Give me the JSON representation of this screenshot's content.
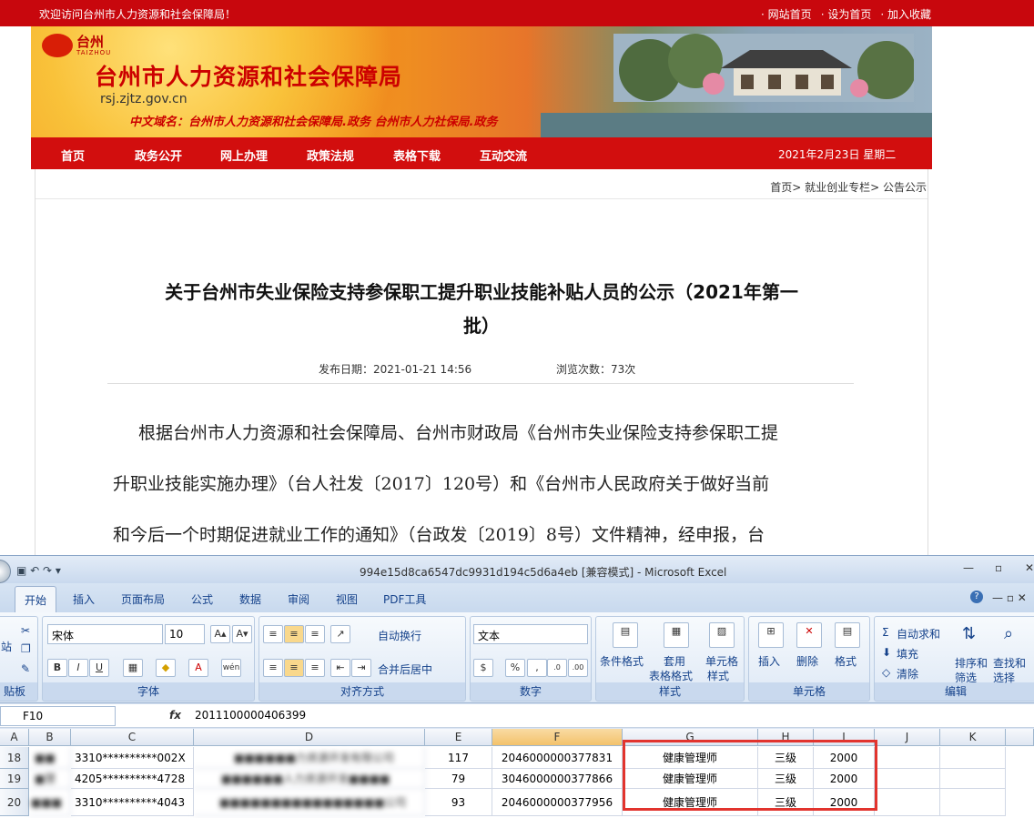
{
  "topbar": {
    "welcome": "欢迎访问台州市人力资源和社会保障局！",
    "links": [
      "网站首页",
      "设为首页",
      "加入收藏"
    ]
  },
  "banner": {
    "logo_text": "台州",
    "logo_sub": "TAIZHOU",
    "org_name": "台州市人力资源和社会保障局",
    "domain": "rsj.zjtz.gov.cn",
    "cn_domain": "中文域名：台州市人力资源和社会保障局.政务   台州市人力社保局.政务"
  },
  "nav": {
    "items": [
      "首页",
      "政务公开",
      "网上办理",
      "政策法规",
      "表格下载",
      "互动交流"
    ],
    "date": "2021年2月23日    星期二"
  },
  "breadcrumb": "首页> 就业创业专栏> 公告公示",
  "article": {
    "title_line1": "关于台州市失业保险支持参保职工提升职业技能补贴人员的公示（2021年第一",
    "title_line2": "批）",
    "publish_date": "发布日期：2021-01-21 14:56",
    "views": "浏览次数：73次",
    "body_lines": [
      "根据台州市人力资源和社会保障局、台州市财政局《台州市失业保险支持参保职工提",
      "升职业技能实施办理》（台人社发〔2017〕120号）和《台州市人民政府关于做好当前",
      "和今后一个时期促进就业工作的通知》（台政发〔2019〕8号）文件精神，经申报，台"
    ]
  },
  "excel": {
    "window_title": "994e15d8ca6547dc9931d194c5d6a4eb  [兼容模式] - Microsoft Excel",
    "tabs": [
      "开始",
      "插入",
      "页面布局",
      "公式",
      "数据",
      "审阅",
      "视图",
      "PDF工具"
    ],
    "active_tab": "开始",
    "ribbon": {
      "clipboard_label": "贴板",
      "font_name": "宋体",
      "font_size": "10",
      "font_group": "字体",
      "wrap_text": "自动换行",
      "merge_center": "合并后居中",
      "align_group": "对齐方式",
      "number_format": "文本",
      "number_group": "数字",
      "cond_format": "条件格式",
      "table_format_1": "套用",
      "table_format_2": "表格格式",
      "cell_style_1": "单元格",
      "cell_style_2": "样式",
      "styles_group": "样式",
      "insert": "插入",
      "delete": "删除",
      "format": "格式",
      "cells_group": "单元格",
      "autosum": "自动求和",
      "fill": "填充",
      "clear": "清除",
      "sort_1": "排序和",
      "sort_2": "筛选",
      "find_1": "查找和",
      "find_2": "选择",
      "edit_group": "编辑"
    },
    "name_box": "F10",
    "fx": "fx",
    "formula_value": "2011100000406399",
    "columns": [
      "A",
      "B",
      "C",
      "D",
      "E",
      "F",
      "G",
      "H",
      "I",
      "J",
      "K"
    ],
    "rows": [
      {
        "num": "18",
        "b": "■■",
        "c": "3310**********002X",
        "d": "■■■■■■力资源开发有限公司",
        "e": "117",
        "f": "2046000000377831",
        "g": "健康管理师",
        "h": "三级",
        "i": "2000"
      },
      {
        "num": "19",
        "b": "■慧",
        "c": "4205**********4728",
        "d": "■■■■■■人力资源开发■■■■",
        "e": "79",
        "f": "3046000000377866",
        "g": "健康管理师",
        "h": "三级",
        "i": "2000"
      },
      {
        "num": "20",
        "b": "■■■",
        "c": "3310**********4043",
        "d": "■■■■■■■■■■■■■■■■公司",
        "e": "93",
        "f": "2046000000377956",
        "g": "健康管理师",
        "h": "三级",
        "i": "2000"
      }
    ]
  }
}
